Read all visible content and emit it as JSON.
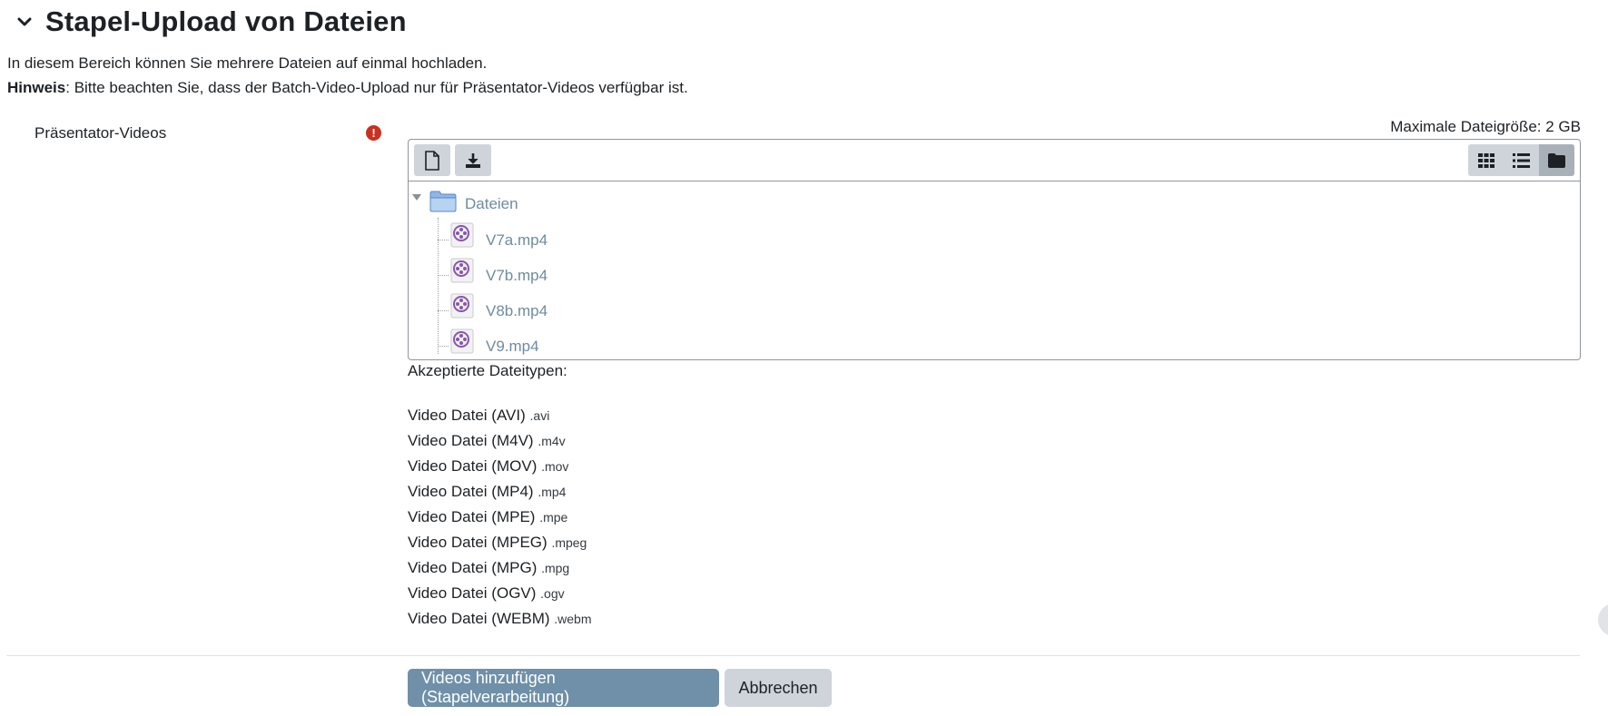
{
  "section": {
    "title": "Stapel-Upload von Dateien",
    "toggle_icon": "chevron-down-icon"
  },
  "intro": {
    "line1": "In diesem Bereich können Sie mehrere Dateien auf einmal hochladen.",
    "note_label": "Hinweis",
    "note_text": ": Bitte beachten Sie, dass der Batch-Video-Upload nur für Präsentator-Videos verfügbar ist."
  },
  "field": {
    "label": "Präsentator-Videos",
    "required_icon": "exclamation-circle-icon",
    "required_color": "#ca3120",
    "required_glyph": "!"
  },
  "filemanager": {
    "max_size": "Maximale Dateigröße: 2 GB",
    "toolbar": {
      "add_icon": "file-icon",
      "download_icon": "download-icon",
      "views": [
        {
          "icon": "grid-view-icon",
          "active": false
        },
        {
          "icon": "list-view-icon",
          "active": false
        },
        {
          "icon": "folder-tree-view-icon",
          "active": true
        }
      ]
    },
    "folder": {
      "name": "Dateien",
      "icon": "folder-icon"
    },
    "files": [
      {
        "name": "V7a.mp4",
        "icon": "video-file-icon"
      },
      {
        "name": "V7b.mp4",
        "icon": "video-file-icon"
      },
      {
        "name": "V8b.mp4",
        "icon": "video-file-icon"
      },
      {
        "name": "V9.mp4",
        "icon": "video-file-icon"
      }
    ],
    "link_color": "#6f8ba0"
  },
  "accepted": {
    "heading": "Akzeptierte Dateitypen:",
    "types": [
      {
        "label": "Video Datei (AVI)",
        "ext": ".avi"
      },
      {
        "label": "Video Datei (M4V)",
        "ext": ".m4v"
      },
      {
        "label": "Video Datei (MOV)",
        "ext": ".mov"
      },
      {
        "label": "Video Datei (MP4)",
        "ext": ".mp4"
      },
      {
        "label": "Video Datei (MPE)",
        "ext": ".mpe"
      },
      {
        "label": "Video Datei (MPEG)",
        "ext": ".mpeg"
      },
      {
        "label": "Video Datei (MPG)",
        "ext": ".mpg"
      },
      {
        "label": "Video Datei (OGV)",
        "ext": ".ogv"
      },
      {
        "label": "Video Datei (WEBM)",
        "ext": ".webm"
      }
    ]
  },
  "actions": {
    "submit_label": "Videos hinzufügen (Stapelverarbeitung)",
    "cancel_label": "Abbrechen",
    "primary_color": "#6f90a8",
    "secondary_color": "#ced4da"
  }
}
